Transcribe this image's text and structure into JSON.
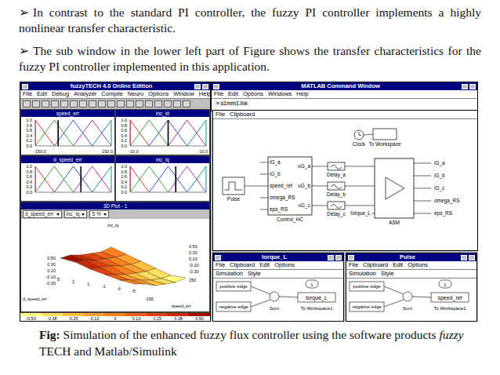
{
  "slide": {
    "bullets": [
      {
        "marker": "➢",
        "text": "In contrast to the standard PI controller, the fuzzy PI controller implements a highly nonlinear transfer characteristic."
      },
      {
        "marker": "➢",
        "text": "The sub window in the lower left part of Figure shows the transfer characteristics for the fuzzy PI controller implemented in this application."
      }
    ],
    "caption": [
      {
        "text": "Fig:",
        "style": "bold"
      },
      {
        "text": " Simulation of the enhanced fuzzy flux controller using the software products ",
        "style": "normal"
      },
      {
        "text": "fuzzy",
        "style": "italic"
      },
      {
        "text": " TECH and Matlab/Simulink",
        "style": "normal"
      }
    ]
  },
  "fuzzytech": {
    "title": "fuzzyTECH 4.0 Online Edition",
    "menu": [
      "File",
      "Edit",
      "Debug",
      "Analyzer",
      "Compile",
      "Neuro",
      "Options",
      "Window",
      "Help"
    ],
    "variables": [
      {
        "name": "speed_err",
        "yticks": [
          "1.0",
          "0.8",
          "0.6",
          "0.4",
          "0.2",
          "0.0"
        ],
        "min": "-150.0",
        "max": "150.0",
        "range": [
          -150,
          150
        ],
        "value": -60,
        "terms": [
          {
            "points": [
              -150,
              -150,
              -75
            ],
            "color": "#d02020"
          },
          {
            "points": [
              -150,
              -75,
              0
            ],
            "color": "#20a020"
          },
          {
            "points": [
              -75,
              0,
              75
            ],
            "color": "#2040d0"
          },
          {
            "points": [
              0,
              75,
              150
            ],
            "color": "#a020a0"
          },
          {
            "points": [
              75,
              150,
              150
            ],
            "color": "#008080"
          }
        ]
      },
      {
        "name": "inc_id",
        "yticks": [
          "1.0",
          "0.8",
          "0.6",
          "0.4",
          "0.2",
          "0.0"
        ],
        "min": "-10.0",
        "max": "10.0",
        "range": [
          -10,
          10
        ],
        "value": 0,
        "terms": [
          {
            "points": [
              -10,
              -10,
              -5
            ],
            "color": "#d02020"
          },
          {
            "points": [
              -10,
              -5,
              0
            ],
            "color": "#20a020"
          },
          {
            "points": [
              -5,
              0,
              5
            ],
            "color": "#2040d0"
          },
          {
            "points": [
              0,
              5,
              10
            ],
            "color": "#a020a0"
          },
          {
            "points": [
              5,
              10,
              10
            ],
            "color": "#008080"
          }
        ]
      },
      {
        "name": "d_speed_err",
        "yticks": [
          "1.0",
          "0.8",
          "0.6",
          "0.4",
          "0.2",
          "0.0"
        ],
        "range": [
          -5,
          5
        ],
        "value": 1,
        "terms": [
          {
            "points": [
              -5,
              -5,
              -2.5
            ],
            "color": "#d02020"
          },
          {
            "points": [
              -5,
              -2.5,
              0
            ],
            "color": "#20a020"
          },
          {
            "points": [
              -2.5,
              0,
              2.5
            ],
            "color": "#2040d0"
          },
          {
            "points": [
              0,
              2.5,
              5
            ],
            "color": "#a020a0"
          },
          {
            "points": [
              2.5,
              5,
              5
            ],
            "color": "#008080"
          }
        ]
      },
      {
        "name": "inc_iq",
        "yticks": [
          "1.0",
          "0.8",
          "0.6",
          "0.4",
          "0.2",
          "0.0"
        ],
        "range": [
          -0.5,
          0.5
        ],
        "value": 0.1,
        "terms": [
          {
            "points": [
              -0.5,
              -0.5,
              -0.25
            ],
            "color": "#d02020"
          },
          {
            "points": [
              -0.5,
              -0.25,
              0
            ],
            "color": "#20a020"
          },
          {
            "points": [
              -0.25,
              0,
              0.25
            ],
            "color": "#2040d0"
          },
          {
            "points": [
              0,
              0.25,
              0.5
            ],
            "color": "#a020a0"
          },
          {
            "points": [
              0.25,
              0.5,
              0.5
            ],
            "color": "#008080"
          }
        ]
      }
    ],
    "plot3d": {
      "title": "3D Plot - 1",
      "fields": [
        "d_speed_err",
        "inc_iq",
        "5 %"
      ],
      "z_label": "inc_iq",
      "z_ticks": [
        "0.50",
        "0.30",
        "0.10",
        "-0.10",
        "-0.30"
      ],
      "z_values": [
        0.5,
        0.3,
        0.1,
        -0.1,
        -0.3
      ],
      "x_label": "d_speed_err",
      "x_ticks": [
        "5",
        "2",
        "1",
        "-1",
        "-3",
        "-5"
      ],
      "y_label": "speed_err",
      "y_ticks": [
        "-150",
        "150"
      ],
      "surface": [
        [
          0.5,
          0.45,
          0.3,
          0.2,
          0.1,
          0.1
        ],
        [
          0.45,
          0.35,
          0.2,
          0.1,
          0.0,
          -0.05
        ],
        [
          0.3,
          0.2,
          0.1,
          -0.05,
          -0.15,
          -0.2
        ],
        [
          0.2,
          0.05,
          -0.1,
          -0.2,
          -0.3,
          -0.35
        ],
        [
          0.1,
          -0.05,
          -0.2,
          -0.35,
          -0.45,
          -0.5
        ],
        [
          0.05,
          -0.1,
          -0.3,
          -0.4,
          -0.5,
          -0.5
        ]
      ]
    },
    "scale": [
      {
        "label": "-0.50",
        "color": "#ffff80"
      },
      {
        "label": "-0.38",
        "color": "#ffe060"
      },
      {
        "label": "-0.25",
        "color": "#ffc040"
      },
      {
        "label": "-0.13",
        "color": "#ffa030"
      },
      {
        "label": "0",
        "color": "#ff8020"
      },
      {
        "label": "0.13",
        "color": "#f06018"
      },
      {
        "label": "0.25",
        "color": "#e04010"
      },
      {
        "label": "0.38",
        "color": "#c82808"
      },
      {
        "label": "0.50",
        "color": "#a01000"
      }
    ]
  },
  "matlab": {
    "title": "MATLAB Command Window",
    "menu": [
      "File",
      "Edit",
      "Options",
      "Windows",
      "Help"
    ],
    "lines": [
      "» s1mm1.lnk"
    ]
  },
  "simulink": {
    "menu": [
      "File",
      "Clipboard"
    ],
    "nodes": [
      {
        "kind": "clock",
        "label": "Clock",
        "in": [],
        "out": []
      },
      {
        "kind": "workspace",
        "label": "To Workspace",
        "in": [],
        "out": []
      },
      {
        "kind": "pulse",
        "label": "Pulse",
        "in": [],
        "out": []
      },
      {
        "kind": "subsystem",
        "label": "Control_HC",
        "in": [
          "iG_a",
          "iG_b",
          "speed_ref",
          "omega_RS",
          "eps_RS"
        ],
        "out": [
          "uG_a",
          "uG_b",
          "uG_c"
        ]
      },
      {
        "kind": "delay",
        "label": "Delay_a",
        "in": [],
        "out": []
      },
      {
        "kind": "delay",
        "label": "Delay_b",
        "in": [],
        "out": []
      },
      {
        "kind": "delay",
        "label": "Delay_c",
        "in": [],
        "out": []
      },
      {
        "kind": "machine",
        "label": "ASM",
        "in": [
          "torque_L"
        ],
        "out": [
          "iG_a",
          "iG_b",
          "iG_c",
          "omega_RS",
          "eps_RS"
        ]
      }
    ]
  },
  "scopes": [
    {
      "title": "torque_L",
      "menu": [
        "File",
        "Clipboard",
        "Edit",
        "Options"
      ],
      "menu2": [
        "Simulation",
        "Style"
      ],
      "pos": "positive edge",
      "neg": "negative edge",
      "sum": "Sum",
      "port": "1",
      "var": "torque_L",
      "sink": "To Workspace1"
    },
    {
      "title": "Pulse",
      "menu": [
        "File",
        "Clipboard",
        "Edit",
        "Options"
      ],
      "menu2": [
        "Simulation",
        "Style"
      ],
      "pos": "positive edge",
      "neg": "negative edge",
      "sum": "Sum",
      "port": "1",
      "var": "speed_ref",
      "sink": "To Workspace1"
    }
  ]
}
